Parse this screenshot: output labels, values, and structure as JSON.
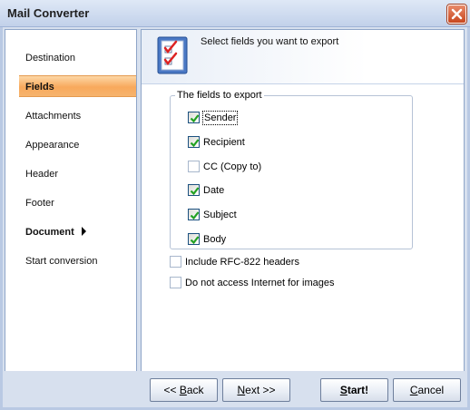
{
  "window": {
    "title": "Mail Converter",
    "close_icon": "close-icon"
  },
  "sidebar": {
    "items": [
      {
        "label": "Destination"
      },
      {
        "label": "Fields",
        "active": true
      },
      {
        "label": "Attachments"
      },
      {
        "label": "Appearance"
      },
      {
        "label": "Header"
      },
      {
        "label": "Footer"
      },
      {
        "label": "Document",
        "submenu": true
      },
      {
        "label": "Start conversion"
      }
    ]
  },
  "content": {
    "header_text": "Select fields you want to export",
    "header_icon": "checklist-icon",
    "group_label": "The fields to export",
    "fields": [
      {
        "label": "Sender",
        "checked": true
      },
      {
        "label": "Recipient",
        "checked": true
      },
      {
        "label": "CC (Copy to)",
        "checked": false
      },
      {
        "label": "Date",
        "checked": true
      },
      {
        "label": "Subject",
        "checked": true
      },
      {
        "label": "Body",
        "checked": true
      }
    ],
    "options": [
      {
        "label": "Include RFC-822 headers",
        "checked": false
      },
      {
        "label": "Do not access Internet for images",
        "checked": false
      }
    ]
  },
  "buttons": {
    "back": {
      "pre": "<< ",
      "u": "B",
      "post": "ack"
    },
    "next": {
      "pre": "",
      "u": "N",
      "post": "ext >>"
    },
    "start": {
      "pre": "",
      "u": "S",
      "post": "tart!"
    },
    "cancel": {
      "pre": "",
      "u": "C",
      "post": "ancel"
    }
  },
  "colors": {
    "accent": "#f8a95c",
    "border": "#8ea5c8",
    "background": "#d7e0ee",
    "check": "#21a121"
  }
}
